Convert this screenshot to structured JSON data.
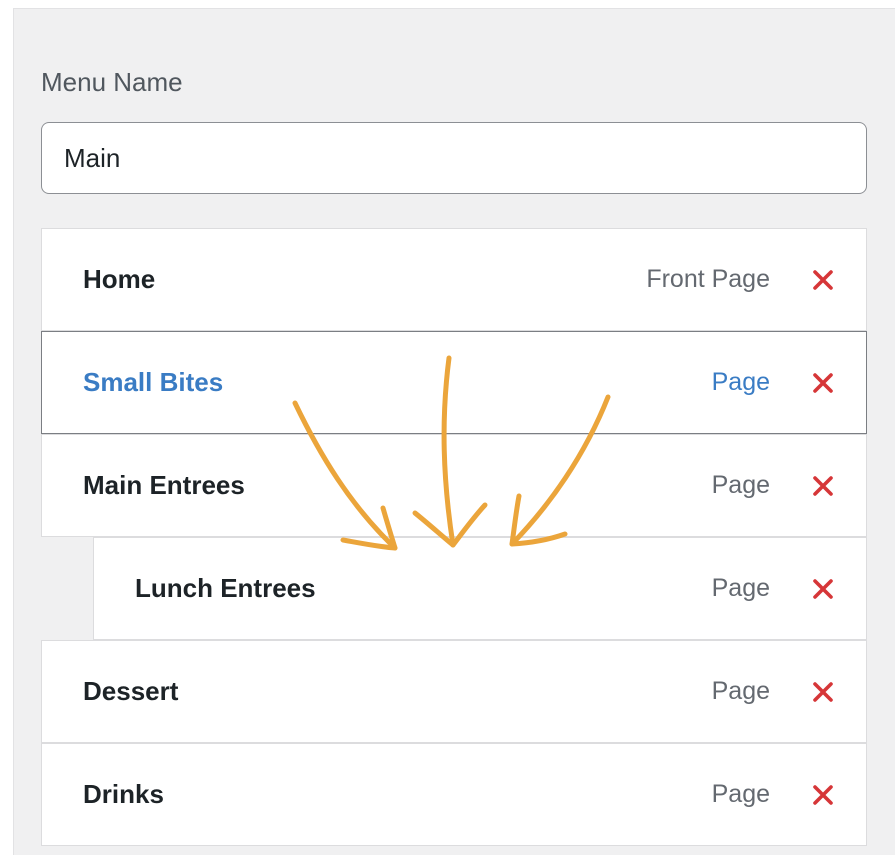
{
  "menu": {
    "name_label": "Menu Name",
    "name_value": "Main",
    "items": [
      {
        "title": "Home",
        "type": "Front Page",
        "active": false,
        "depth": 0
      },
      {
        "title": "Small Bites",
        "type": "Page",
        "active": true,
        "depth": 0
      },
      {
        "title": "Main Entrees",
        "type": "Page",
        "active": false,
        "depth": 0
      },
      {
        "title": "Lunch Entrees",
        "type": "Page",
        "active": false,
        "depth": 1
      },
      {
        "title": "Dessert",
        "type": "Page",
        "active": false,
        "depth": 0
      },
      {
        "title": "Drinks",
        "type": "Page",
        "active": false,
        "depth": 0
      }
    ]
  },
  "colors": {
    "remove_icon": "#d63638",
    "active_link": "#3a7cc4",
    "annotation_arrows": "#eba53b"
  }
}
